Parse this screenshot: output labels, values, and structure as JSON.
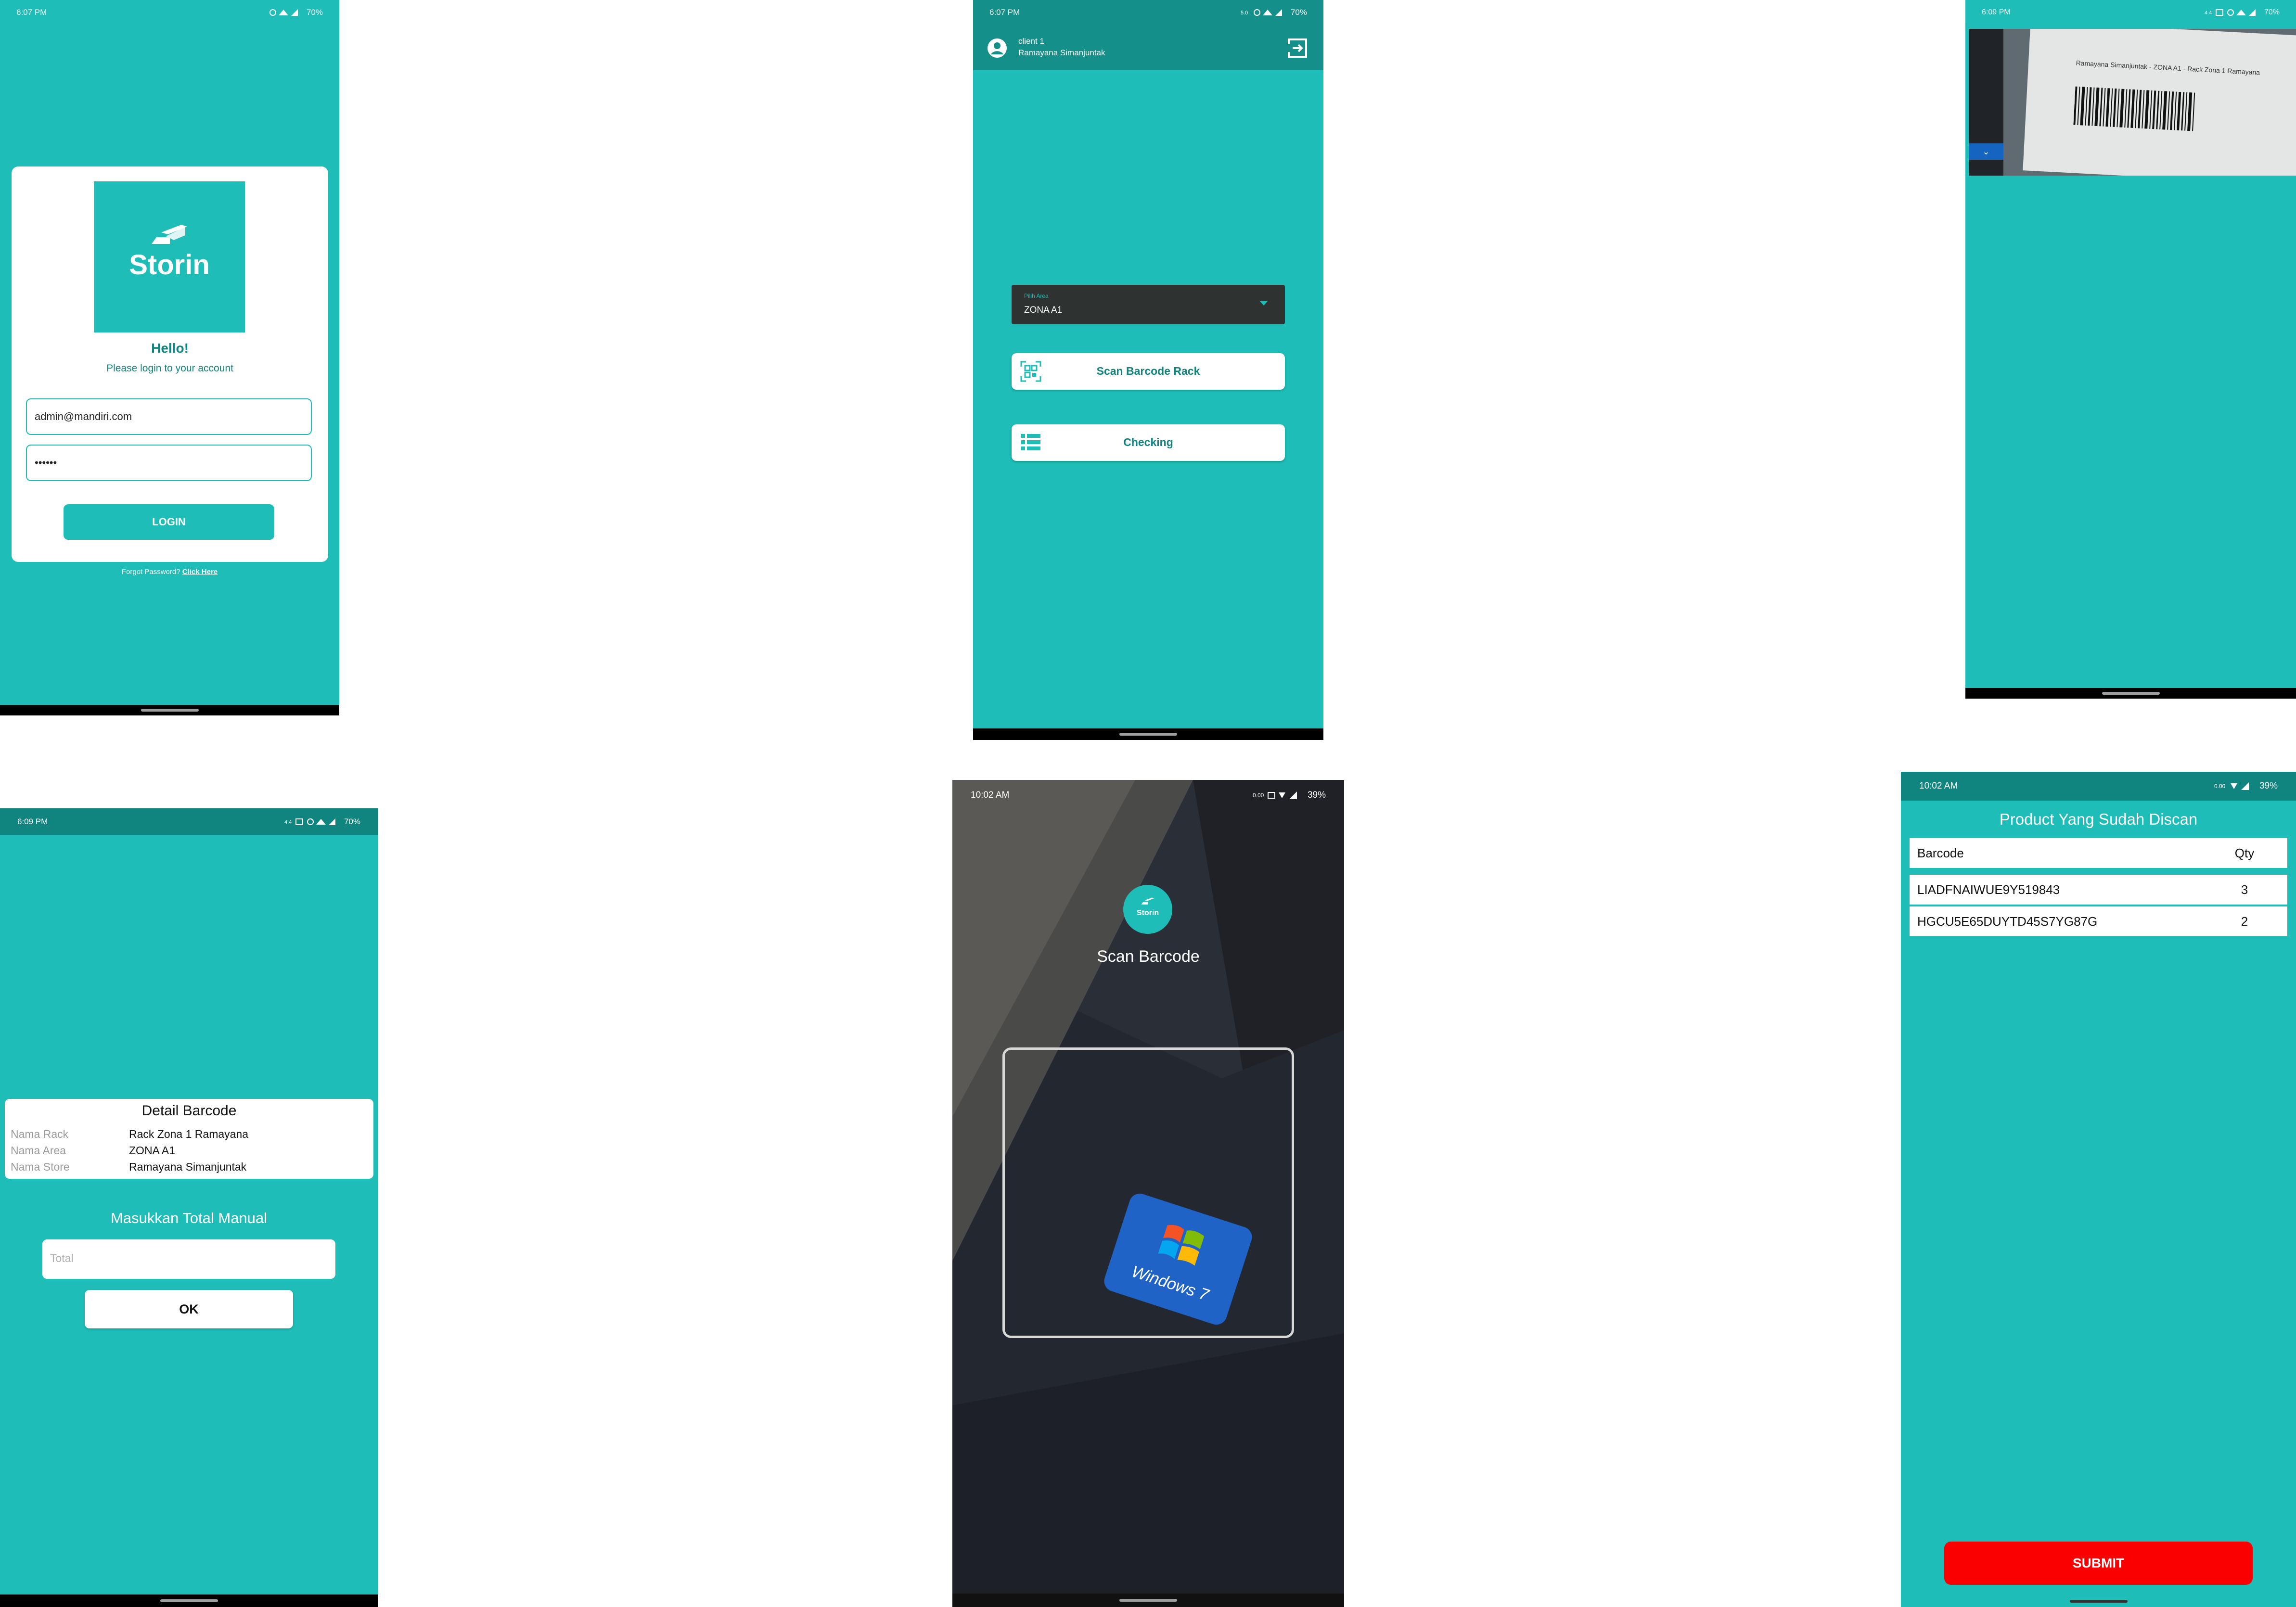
{
  "colors": {
    "teal": "#1ebdb7",
    "teal_dark": "#10857f",
    "dark_field": "#2e3231",
    "red": "#fb0000"
  },
  "screen1": {
    "time": "6:07 PM",
    "battery": "70%",
    "brand": "Storin",
    "hello": "Hello!",
    "subtitle": "Please login to your account",
    "email_value": "admin@mandiri.com",
    "password_value": "••••••",
    "login_label": "LOGIN",
    "forgot_text": "Forgot Password?",
    "click_here": "Click Here"
  },
  "screen2": {
    "time": "6:07 PM",
    "battery": "70%",
    "client": "client 1",
    "user": "Ramayana Simanjuntak",
    "area_label": "Pilih Area",
    "area_value": "ZONA A1",
    "scan_label": "Scan Barcode Rack",
    "checking_label": "Checking"
  },
  "screen3": {
    "time": "6:09 PM",
    "battery": "70%",
    "preview_label": "Ramayana Simanjuntak - ZONA A1 - Rack Zona 1 Ramayana"
  },
  "screen4": {
    "time": "6:09 PM",
    "battery": "70%",
    "detail_title": "Detail Barcode",
    "rows": [
      {
        "label": "Nama Rack",
        "value": "Rack Zona 1 Ramayana"
      },
      {
        "label": "Nama Area",
        "value": "ZONA A1"
      },
      {
        "label": "Nama Store",
        "value": "Ramayana Simanjuntak"
      }
    ],
    "manual_title": "Masukkan Total Manual",
    "total_placeholder": "Total",
    "ok_label": "OK"
  },
  "screen5": {
    "time": "10:02 AM",
    "battery": "39%",
    "logo_text": "Storin",
    "title": "Scan Barcode",
    "sticker_text": "Windows 7"
  },
  "screen6": {
    "time": "10:02 AM",
    "battery": "39%",
    "title": "Product Yang Sudah Discan",
    "col_barcode": "Barcode",
    "col_qty": "Qty",
    "rows": [
      {
        "barcode": "LIADFNAIWUE9Y519843",
        "qty": "3"
      },
      {
        "barcode": "HGCU5E65DUYTD45S7YG87G",
        "qty": "2"
      }
    ],
    "submit_label": "SUBMIT"
  }
}
